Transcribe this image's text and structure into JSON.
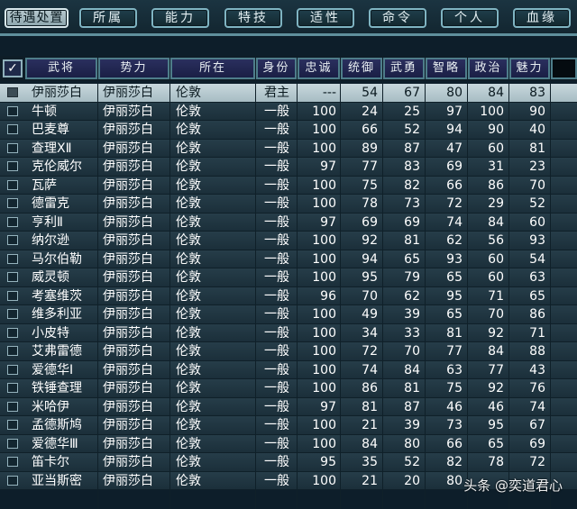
{
  "tabs": [
    {
      "label": "待遇处置",
      "active": true
    },
    {
      "label": "所属",
      "active": false
    },
    {
      "label": "能力",
      "active": false
    },
    {
      "label": "特技",
      "active": false
    },
    {
      "label": "适性",
      "active": false
    },
    {
      "label": "命令",
      "active": false
    },
    {
      "label": "个人",
      "active": false
    },
    {
      "label": "血缘",
      "active": false
    }
  ],
  "table": {
    "check_header": "✓",
    "columns": [
      "武将",
      "势力",
      "所在",
      "身份",
      "忠诚",
      "统御",
      "武勇",
      "智略",
      "政治",
      "魅力"
    ],
    "rows": [
      {
        "name": "伊丽莎白",
        "faction": "伊丽莎白",
        "location": "伦敦",
        "status": "君主",
        "loyalty": "---",
        "command": "54",
        "valor": "67",
        "intellect": "80",
        "politics": "84",
        "charisma": "83",
        "selected": true
      },
      {
        "name": "牛顿",
        "faction": "伊丽莎白",
        "location": "伦敦",
        "status": "一般",
        "loyalty": "100",
        "command": "24",
        "valor": "25",
        "intellect": "97",
        "politics": "100",
        "charisma": "90"
      },
      {
        "name": "巴麦尊",
        "faction": "伊丽莎白",
        "location": "伦敦",
        "status": "一般",
        "loyalty": "100",
        "command": "66",
        "valor": "52",
        "intellect": "94",
        "politics": "90",
        "charisma": "40"
      },
      {
        "name": "查理ⅩⅡ",
        "faction": "伊丽莎白",
        "location": "伦敦",
        "status": "一般",
        "loyalty": "100",
        "command": "89",
        "valor": "87",
        "intellect": "47",
        "politics": "60",
        "charisma": "81"
      },
      {
        "name": "克伦威尔",
        "faction": "伊丽莎白",
        "location": "伦敦",
        "status": "一般",
        "loyalty": "97",
        "command": "77",
        "valor": "83",
        "intellect": "69",
        "politics": "31",
        "charisma": "23"
      },
      {
        "name": "瓦萨",
        "faction": "伊丽莎白",
        "location": "伦敦",
        "status": "一般",
        "loyalty": "100",
        "command": "75",
        "valor": "82",
        "intellect": "66",
        "politics": "86",
        "charisma": "70"
      },
      {
        "name": "德雷克",
        "faction": "伊丽莎白",
        "location": "伦敦",
        "status": "一般",
        "loyalty": "100",
        "command": "78",
        "valor": "73",
        "intellect": "72",
        "politics": "29",
        "charisma": "52"
      },
      {
        "name": "亨利Ⅱ",
        "faction": "伊丽莎白",
        "location": "伦敦",
        "status": "一般",
        "loyalty": "97",
        "command": "69",
        "valor": "69",
        "intellect": "74",
        "politics": "84",
        "charisma": "60"
      },
      {
        "name": "纳尔逊",
        "faction": "伊丽莎白",
        "location": "伦敦",
        "status": "一般",
        "loyalty": "100",
        "command": "92",
        "valor": "81",
        "intellect": "62",
        "politics": "56",
        "charisma": "93"
      },
      {
        "name": "马尔伯勒",
        "faction": "伊丽莎白",
        "location": "伦敦",
        "status": "一般",
        "loyalty": "100",
        "command": "94",
        "valor": "65",
        "intellect": "93",
        "politics": "60",
        "charisma": "54"
      },
      {
        "name": "威灵顿",
        "faction": "伊丽莎白",
        "location": "伦敦",
        "status": "一般",
        "loyalty": "100",
        "command": "95",
        "valor": "79",
        "intellect": "65",
        "politics": "60",
        "charisma": "63"
      },
      {
        "name": "考塞维茨",
        "faction": "伊丽莎白",
        "location": "伦敦",
        "status": "一般",
        "loyalty": "96",
        "command": "70",
        "valor": "62",
        "intellect": "95",
        "politics": "71",
        "charisma": "65"
      },
      {
        "name": "维多利亚",
        "faction": "伊丽莎白",
        "location": "伦敦",
        "status": "一般",
        "loyalty": "100",
        "command": "49",
        "valor": "39",
        "intellect": "65",
        "politics": "70",
        "charisma": "86"
      },
      {
        "name": "小皮特",
        "faction": "伊丽莎白",
        "location": "伦敦",
        "status": "一般",
        "loyalty": "100",
        "command": "34",
        "valor": "33",
        "intellect": "81",
        "politics": "92",
        "charisma": "71"
      },
      {
        "name": "艾弗雷德",
        "faction": "伊丽莎白",
        "location": "伦敦",
        "status": "一般",
        "loyalty": "100",
        "command": "72",
        "valor": "70",
        "intellect": "77",
        "politics": "84",
        "charisma": "88"
      },
      {
        "name": "爱德华Ⅰ",
        "faction": "伊丽莎白",
        "location": "伦敦",
        "status": "一般",
        "loyalty": "100",
        "command": "74",
        "valor": "84",
        "intellect": "63",
        "politics": "77",
        "charisma": "43"
      },
      {
        "name": "铁锤查理",
        "faction": "伊丽莎白",
        "location": "伦敦",
        "status": "一般",
        "loyalty": "100",
        "command": "86",
        "valor": "81",
        "intellect": "75",
        "politics": "92",
        "charisma": "76"
      },
      {
        "name": "米哈伊",
        "faction": "伊丽莎白",
        "location": "伦敦",
        "status": "一般",
        "loyalty": "97",
        "command": "81",
        "valor": "87",
        "intellect": "46",
        "politics": "46",
        "charisma": "74"
      },
      {
        "name": "孟德斯鸠",
        "faction": "伊丽莎白",
        "location": "伦敦",
        "status": "一般",
        "loyalty": "100",
        "command": "21",
        "valor": "39",
        "intellect": "73",
        "politics": "95",
        "charisma": "67"
      },
      {
        "name": "爱德华Ⅲ",
        "faction": "伊丽莎白",
        "location": "伦敦",
        "status": "一般",
        "loyalty": "100",
        "command": "84",
        "valor": "80",
        "intellect": "66",
        "politics": "65",
        "charisma": "69"
      },
      {
        "name": "笛卡尔",
        "faction": "伊丽莎白",
        "location": "伦敦",
        "status": "一般",
        "loyalty": "95",
        "command": "35",
        "valor": "52",
        "intellect": "82",
        "politics": "78",
        "charisma": "72"
      },
      {
        "name": "亚当斯密",
        "faction": "伊丽莎白",
        "location": "伦敦",
        "status": "一般",
        "loyalty": "100",
        "command": "21",
        "valor": "20",
        "intellect": "80",
        "politics": "",
        "charisma": ""
      }
    ]
  },
  "watermark": "头条 @奕道君心"
}
